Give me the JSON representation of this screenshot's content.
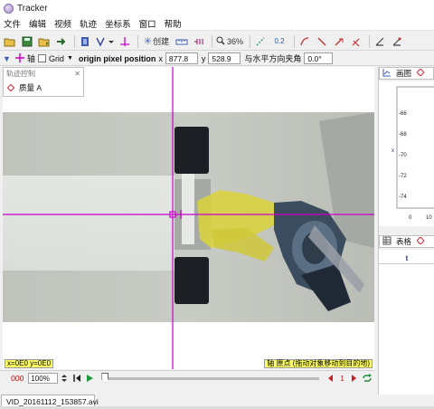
{
  "window": {
    "title": "Tracker"
  },
  "menu": [
    "文件",
    "编辑",
    "视频",
    "轨迹",
    "坐标系",
    "窗口",
    "帮助"
  ],
  "toolbar": {
    "create_label": "创建",
    "zoom_label": "36%",
    "calib_label": "0.2"
  },
  "axis": {
    "axes_label": "轴",
    "grid_label": "Grid",
    "origin_label": "origin pixel position",
    "x_label": "x",
    "x_value": "877.8",
    "y_label": "y",
    "y_value": "528.9",
    "angle_label": "与水平方向夹角",
    "angle_value": "0.0°"
  },
  "tracks_panel": {
    "title": "轨迹控制",
    "close": "✕",
    "item": "质量 A"
  },
  "video": {
    "coord_readout": "x=0E0  y=0E0",
    "status_msg": "轴 原点 (拖动对象移动到目的地)"
  },
  "playback": {
    "frame_number": "000",
    "zoom_value": "100%",
    "step_value": "1",
    "progress": 0
  },
  "file_tab": {
    "name": "VID_20161112_153857.avi"
  },
  "right_panel": {
    "plot_tab_label": "画图",
    "table_tab_label": "表格",
    "y_axis_label": "x",
    "y_ticks": [
      "-66",
      "-68",
      "-70",
      "-72",
      "-74"
    ],
    "x_ticks": [
      "0",
      "10"
    ],
    "table_column": "t"
  },
  "colors": {
    "axis_magenta": "#cc00cc",
    "readout_bg": "#ffff66",
    "track_red": "#dd2233"
  }
}
